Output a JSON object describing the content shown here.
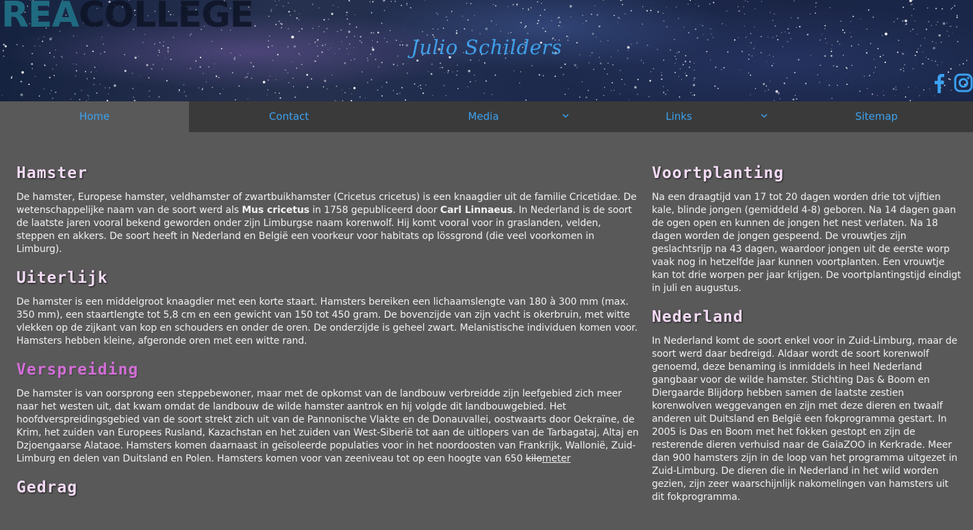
{
  "header": {
    "logo_part1": "REA",
    "logo_part2": "COLLEGE",
    "site_title": "Julio Schilders",
    "social": [
      {
        "icon": "facebook-icon"
      },
      {
        "icon": "instagram-icon"
      }
    ]
  },
  "nav": {
    "items": [
      {
        "label": "Home",
        "active": true,
        "dropdown": false
      },
      {
        "label": "Contact",
        "active": false,
        "dropdown": false
      },
      {
        "label": "Media",
        "active": false,
        "dropdown": true
      },
      {
        "label": "Links",
        "active": false,
        "dropdown": true
      },
      {
        "label": "Sitemap",
        "active": false,
        "dropdown": false
      }
    ],
    "link_color": "#3ba1f0"
  },
  "left": {
    "hamster": {
      "title": "Hamster",
      "p1": "De hamster, Europese hamster, veldhamster of zwartbuikhamster (Cricetus cricetus) is een knaagdier uit de familie Cricetidae. De wetenschappelijke naam van de soort werd als ",
      "bold1": "Mus cricetus",
      "p2": " in 1758 gepubliceerd door ",
      "bold2": "Carl Linnaeus",
      "p3": ". In Nederland is de soort de laatste jaren vooral bekend geworden onder zijn Limburgse naam korenwolf. Hij komt vooral voor in graslanden, velden, steppen en akkers. De soort heeft in Nederland en België een voorkeur voor habitats op lössgrond (die veel voorkomen in Limburg)."
    },
    "uiterlijk": {
      "title": "Uiterlijk",
      "text": "De hamster is een middelgroot knaagdier met een korte staart. Hamsters bereiken een lichaamslengte van 180 à 300 mm (max. 350 mm), een staartlengte tot 5,8 cm en een gewicht van 150 tot 450 gram. De bovenzijde van zijn vacht is okerbruin, met witte vlekken op de zijkant van kop en schouders en onder de oren. De onderzijde is geheel zwart. Melanistische individuen komen voor. Hamsters hebben kleine, afgeronde oren met een witte rand."
    },
    "verspreiding": {
      "title": "Verspreiding",
      "text": "De hamster is van oorsprong een steppebewoner, maar met de opkomst van de landbouw verbreidde zijn leefgebied zich meer naar het westen uit, dat kwam omdat de landbouw de wilde hamster aantrok en hij volgde dit landbouwgebied. Het hoofdverspreidingsgebied van de soort strekt zich uit van de Pannonische Vlakte en de Donauvallei, oostwaarts door Oekraïne, de Krim, het zuiden van Europees Rusland, Kazachstan en het zuiden van West-Siberië tot aan de uitlopers van de Tarbagataj, Altaj en Dzjoengaarse Alataoe. Hamsters komen daarnaast in geïsoleerde populaties voor in het noordoosten van Frankrijk, Wallonië, Zuid-Limburg en delen van Duitsland en Polen. Hamsters komen voor van zeeniveau tot op een hoogte van 650 ",
      "strike": "kilo",
      "link": "meter"
    },
    "gedrag": {
      "title": "Gedrag"
    }
  },
  "right": {
    "voortplanting": {
      "title": "Voortplanting",
      "text": "Na een draagtijd van 17 tot 20 dagen worden drie tot vijftien kale, blinde jongen (gemiddeld 4-8) geboren. Na 14 dagen gaan de ogen open en kunnen de jongen het nest verlaten. Na 18 dagen worden de jongen gespeend. De vrouwtjes zijn geslachtsrijp na 43 dagen, waardoor jongen uit de eerste worp vaak nog in hetzelfde jaar kunnen voortplanten. Een vrouwtje kan tot drie worpen per jaar krijgen. De voortplantingstijd eindigt in juli en augustus."
    },
    "nederland": {
      "title": "Nederland",
      "text": "In Nederland komt de soort enkel voor in Zuid-Limburg, maar de soort werd daar bedreigd. Aldaar wordt de soort korenwolf genoemd, deze benaming is inmiddels in heel Nederland gangbaar voor de wilde hamster. Stichting Das & Boom en Diergaarde Blijdorp hebben samen de laatste zestien korenwolven weggevangen en zijn met deze dieren en twaalf anderen uit Duitsland en België een fokprogramma gestart. In 2005 is Das en Boom met het fokken gestopt en zijn de resterende dieren verhuisd naar de GaiaZOO in Kerkrade. Meer dan 900 hamsters zijn in de loop van het programma uitgezet in Zuid-Limburg. De dieren die in Nederland in het wild worden gezien, zijn zeer waarschijnlijk nakomelingen van hamsters uit dit fokprogramma."
    }
  }
}
